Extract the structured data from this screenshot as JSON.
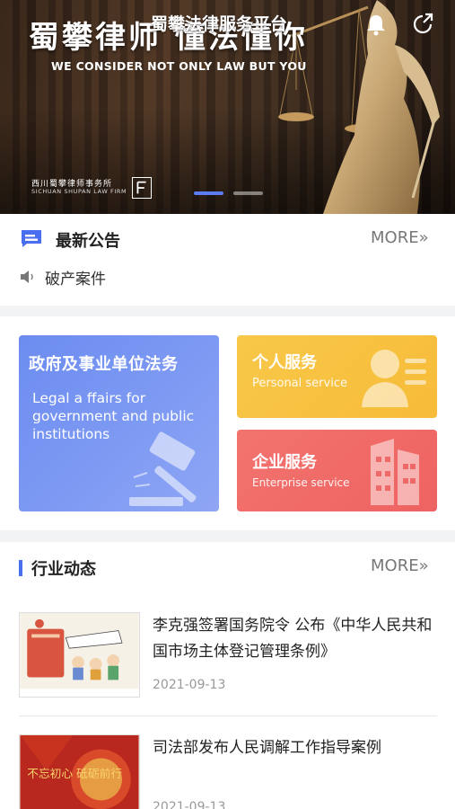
{
  "hero": {
    "tagline_cn": "蜀攀律师  懂法懂你",
    "tagline_en": "WE CONSIDER NOT ONLY LAW BUT YOU",
    "platform_title": "蜀攀法律服务平台",
    "firm_name_cn": "西川蜀攀律师事务所",
    "firm_name_en": "SICHUAN SHUPAN LAW FIRM",
    "carousel_active": 1,
    "carousel_total": 2,
    "icons": {
      "bell": "bell-icon",
      "share": "share-icon"
    }
  },
  "notice": {
    "heading": "最新公告",
    "more": "MORE»",
    "item": "破产案件",
    "icons": {
      "section": "message-icon",
      "item": "speaker-icon"
    }
  },
  "services": {
    "gov": {
      "title": "政府及事业单位法务",
      "desc": "Legal a ffairs for government and public institutions"
    },
    "personal": {
      "title": "个人服务",
      "subtitle": "Personal service"
    },
    "enterprise": {
      "title": "企业服务",
      "subtitle": "Enterprise service"
    }
  },
  "news": {
    "heading": "行业动态",
    "more": "MORE»",
    "articles": [
      {
        "title": "李克强签署国务院令 公布《中华人民共和国市场主体登记管理条例》",
        "date": "2021-09-13"
      },
      {
        "title": "司法部发布人民调解工作指导案例",
        "date": "2021-09-13",
        "thumb_text": "不忘初心 砥砺前行"
      }
    ]
  },
  "colors": {
    "accent": "#4a6ef0",
    "gov_card": "#7b96f2",
    "personal_card": "#f8c244",
    "enterprise_card": "#f06a67",
    "more_text": "#777777",
    "date_text": "#999999"
  }
}
